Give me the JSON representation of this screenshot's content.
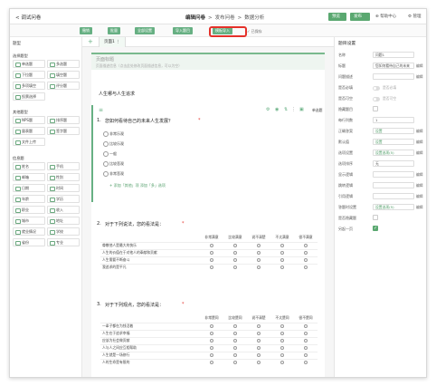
{
  "topbar": {
    "back": "< 调试问卷",
    "steps": [
      "编辑问卷",
      ">",
      "发布问卷",
      ">",
      "数据分析"
    ],
    "preview": "预览",
    "publish": "发布",
    "help": "帮助中心",
    "manage": "管理"
  },
  "toolbar": {
    "buttons": [
      "撤销",
      "批量",
      "全部设置",
      "导入题目",
      "模板导入"
    ],
    "saved": "已保存"
  },
  "left": {
    "title": "题型",
    "groups": [
      {
        "name": "选择题型",
        "items": [
          "单选题",
          "多选题",
          "下拉题",
          "填空题",
          "多项填空",
          "评分题",
          "投票选择"
        ]
      },
      {
        "name": "其他题型",
        "items": [
          "NPS题",
          "排序题",
          "量表题",
          "签字题",
          "文件上传"
        ]
      },
      {
        "name": "信息题",
        "items": [
          "姓名",
          "手机",
          "邮箱",
          "性别",
          "日期",
          "时间",
          "年龄",
          "学历",
          "职业",
          "收入",
          "城市",
          "地址",
          "就业情况",
          "学校",
          "省份",
          "专业"
        ]
      }
    ]
  },
  "center": {
    "tab": "页面1",
    "page_title": "页面标题",
    "page_desc": "页面描述信息（点击此处修改页面描述信息，可以为空）",
    "section": "人生哪与人生追求",
    "q1": {
      "num": "1.",
      "title": "您如何看待自己的未来人生发展？",
      "required": "*",
      "options": [
        "非常乐观",
        "比较乐观",
        "一般",
        "比较悲观",
        "非常悲观"
      ],
      "add": "+ 添加「其他」项   添加「多」选项",
      "style": "单选题"
    },
    "q2": {
      "num": "2.",
      "title": "对于下列说法，您的看法是：",
      "required": "*",
      "cols": [
        "非常满意",
        "比较满意",
        "说不清楚",
        "不太满意",
        "很不满意"
      ],
      "rows": [
        "尊敬他人是最大的快乐",
        "人生的价值在于对他人的奉献和贡献",
        "人生需要不断奋斗",
        "我追求的是平凡"
      ]
    },
    "q3": {
      "num": "3.",
      "title": "对于下列观点，您的看法是：",
      "required": "*",
      "cols": [
        "非常赞同",
        "比较赞同",
        "说不清楚",
        "不太赞同",
        "很不赞同"
      ],
      "rows": [
        "一辈子都在为钱活着",
        "人生在于追求幸福",
        "应该为社会做贡献",
        "人与人之间应互相帮助",
        "人生就是一场修行",
        "人的生命是有限的"
      ]
    }
  },
  "right": {
    "title": "题目设置",
    "fields": [
      {
        "label": "名称",
        "value": "问题1"
      },
      {
        "label": "标题",
        "value": "您如何看待自己的未来",
        "edit": "编辑"
      },
      {
        "label": "问题描述",
        "value": "",
        "edit": "编辑"
      },
      {
        "label": "是否必填",
        "toggle": "是否必填"
      },
      {
        "label": "是否可空",
        "toggle": "是否可空"
      },
      {
        "label": "隐藏题目",
        "check": false
      },
      {
        "label": "每行列数",
        "value": "1"
      },
      {
        "label": "正确答案",
        "value": "设置",
        "edit": "编辑"
      },
      {
        "label": "默认值",
        "value": "设置",
        "edit": "编辑"
      },
      {
        "label": "选项设置",
        "value": "设置选项(5)",
        "edit": "编辑"
      },
      {
        "label": "选项排序",
        "value": "无"
      },
      {
        "label": "显示逻辑",
        "value": "",
        "edit": "编辑"
      },
      {
        "label": "跳转逻辑",
        "value": "",
        "edit": "编辑"
      },
      {
        "label": "引用逻辑",
        "value": "",
        "edit": "编辑"
      },
      {
        "label": "答题时设置",
        "value": "设置选项(5)",
        "edit": "编辑"
      },
      {
        "label": "是否隐藏题",
        "check": false
      },
      {
        "label": "另起一页",
        "check": true
      }
    ]
  },
  "colors": {
    "accent": "#5aa870",
    "highlight": "#e5312a"
  }
}
